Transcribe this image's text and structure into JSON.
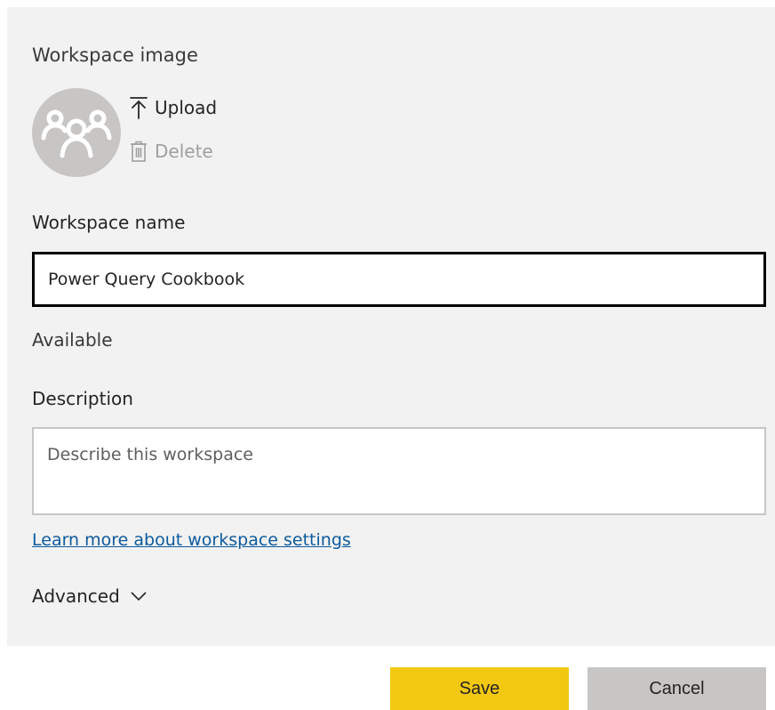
{
  "workspace_image": {
    "title": "Workspace image",
    "avatar_icon": "group-icon",
    "upload_label": "Upload",
    "delete_label": "Delete"
  },
  "workspace_name": {
    "label": "Workspace name",
    "value": "Power Query Cookbook",
    "availability": "Available"
  },
  "description": {
    "label": "Description",
    "placeholder": "Describe this workspace",
    "value": ""
  },
  "links": {
    "learn_more": "Learn more about workspace settings"
  },
  "advanced": {
    "label": "Advanced",
    "icon": "chevron-down-icon"
  },
  "buttons": {
    "save": "Save",
    "cancel": "Cancel"
  },
  "colors": {
    "panel_bg": "#f2f2f2",
    "save_bg": "#f2c811",
    "cancel_bg": "#c8c6c4",
    "link": "#0c5a9e",
    "avatar_bg": "#c8c6c4"
  }
}
